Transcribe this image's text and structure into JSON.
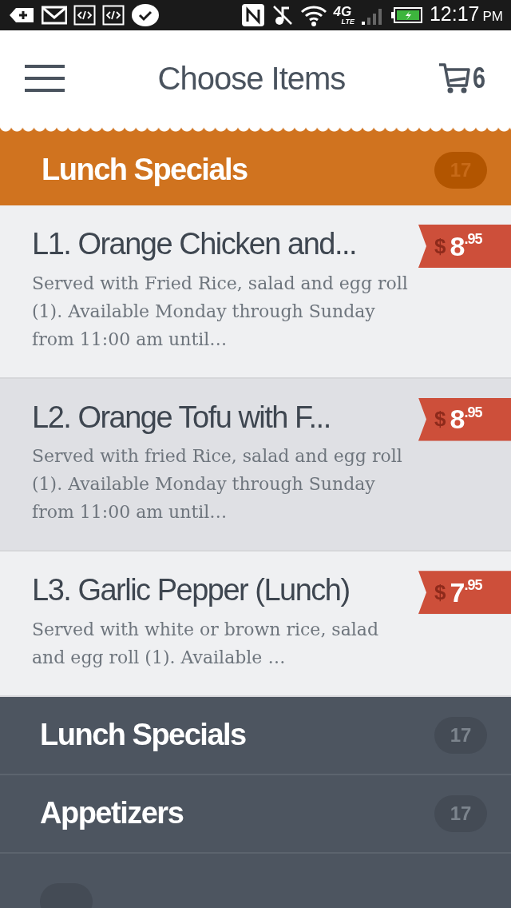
{
  "status_bar": {
    "network": "4G",
    "network_sub": "LTE",
    "time": "12:17",
    "meridiem": "PM"
  },
  "header": {
    "title": "Choose Items",
    "cart_count": "6"
  },
  "category": {
    "name": "Lunch Specials",
    "count": "17"
  },
  "items": [
    {
      "name": "L1. Orange Chicken and...",
      "description": "Served with Fried Rice, salad and egg roll (1). Available Monday through Sunday from 11:00 am until…",
      "currency": "$",
      "whole": "8",
      "cents": ".95",
      "selected": false
    },
    {
      "name": "L2. Orange Tofu with F...",
      "description": "Served with fried Rice, salad and egg roll (1). Available Monday through Sunday from 11:00 am until…",
      "currency": "$",
      "whole": "8",
      "cents": ".95",
      "selected": true
    },
    {
      "name": "L3. Garlic Pepper (Lunch)",
      "description": "Served with white or brown rice, salad and egg roll (1). Available …",
      "currency": "$",
      "whole": "7",
      "cents": ".95",
      "selected": false
    }
  ],
  "categories": [
    {
      "kind": "full",
      "name": "Lunch Specials",
      "count": "17"
    },
    {
      "kind": "full",
      "name": "Appetizers",
      "count": "17"
    },
    {
      "kind": "cut"
    }
  ]
}
